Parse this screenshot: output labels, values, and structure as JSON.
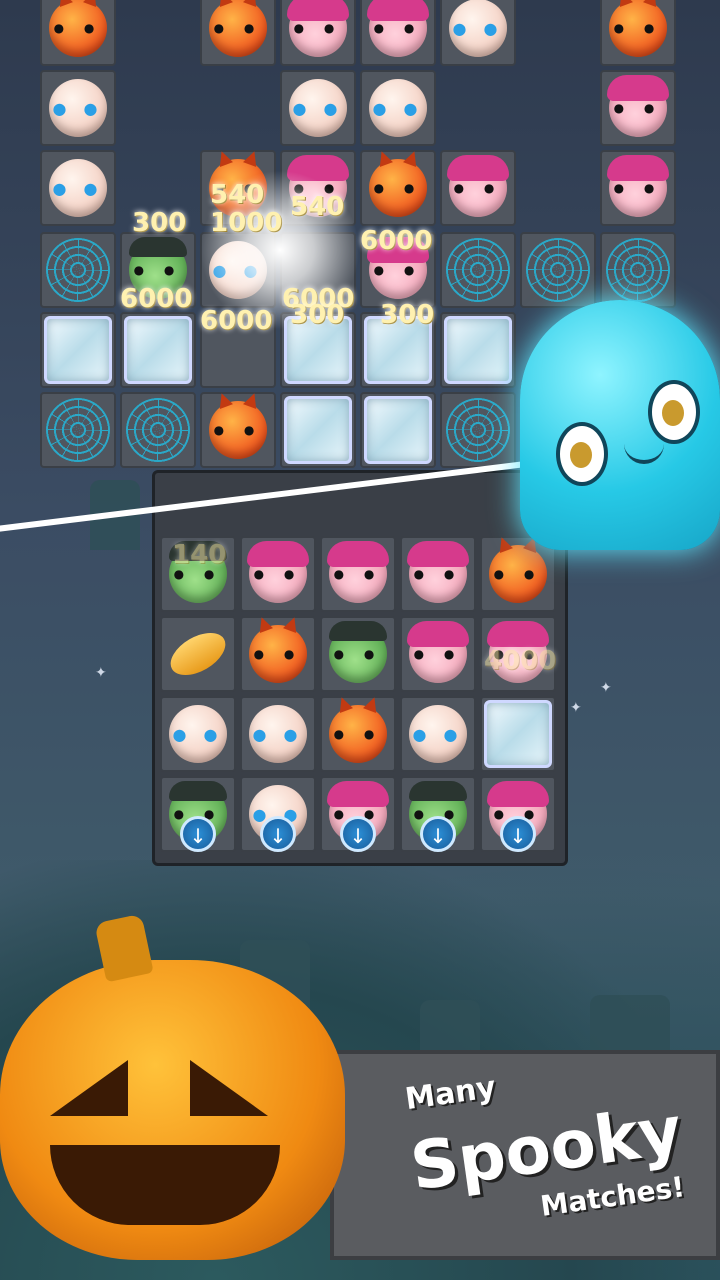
{
  "scene": {
    "scores": [
      "300",
      "540",
      "1000",
      "540",
      "6000",
      "6000",
      "6000",
      "6000",
      "300",
      "300",
      "6000",
      "140",
      "4000"
    ],
    "banner": {
      "line1": "Many",
      "line2": "Spooky",
      "line3": "Matches!"
    }
  },
  "colors": {
    "accent": "#27c9e6",
    "pumpkin": "#f08a12",
    "banner": "#5a5c60"
  },
  "icons": {
    "move_down": "arrow-down-icon"
  }
}
